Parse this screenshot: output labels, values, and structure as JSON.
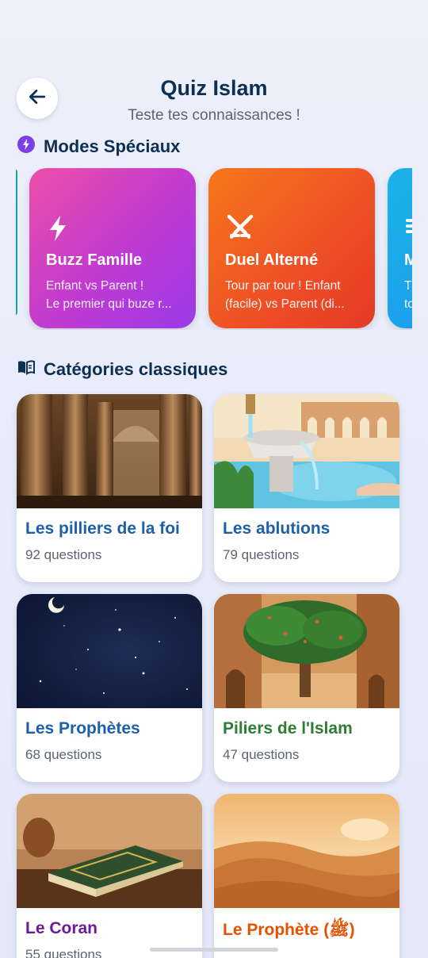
{
  "header": {
    "title": "Quiz Islam",
    "subtitle": "Teste tes connaissances !"
  },
  "special_modes": {
    "title": "Modes Spéciaux",
    "items": [
      {
        "name": "Buzz Famille",
        "desc_line1": "Enfant vs Parent !",
        "desc_line2": "Le premier qui buze r...",
        "icon": "lightning-icon",
        "color_from": "#ea4fa8",
        "color_to": "#9a3ae8"
      },
      {
        "name": "Duel Alterné",
        "desc_line1": "Tour par tour ! Enfant",
        "desc_line2": "(facile) vs Parent (di...",
        "icon": "crossed-swords-icon",
        "color_from": "#f5761a",
        "color_to": "#e43a26"
      },
      {
        "name": "M",
        "desc_line1": "T",
        "desc_line2": "to",
        "icon": "menu-icon",
        "color_from": "#19b4e6",
        "color_to": "#1e8ff0"
      }
    ]
  },
  "categories": {
    "title": "Catégories classiques",
    "items": [
      {
        "name": "Les pilliers de la foi",
        "count": "92 questions",
        "color": "#1d5fa8",
        "image": "ancient-pillars-image"
      },
      {
        "name": "Les ablutions",
        "count": "79 questions",
        "color": "#1d5fa8",
        "image": "fountain-ablution-image"
      },
      {
        "name": "Les Prophètes",
        "count": "68 questions",
        "color": "#1d5fa8",
        "image": "night-sky-image"
      },
      {
        "name": "Piliers de l'Islam",
        "count": "47 questions",
        "color": "#2e7d32",
        "image": "tree-alley-image"
      },
      {
        "name": "Le Coran",
        "count": "55 questions",
        "color": "#6a1b9a",
        "image": "quran-book-image"
      },
      {
        "name": "Le Prophète (ﷺ)",
        "count": "",
        "color": "#e65100",
        "image": "desert-dunes-image"
      }
    ]
  }
}
